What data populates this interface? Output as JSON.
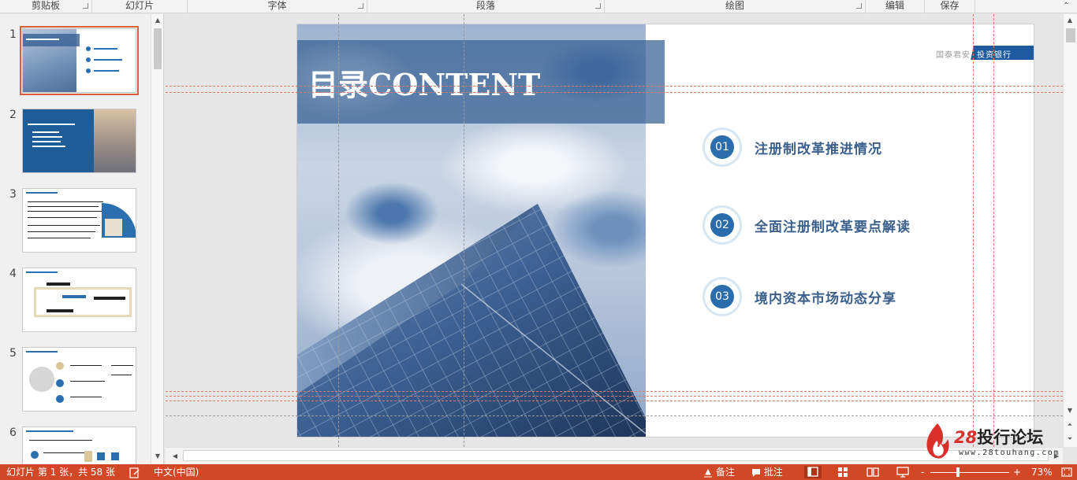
{
  "ribbon": {
    "groups": [
      {
        "label": "剪贴板",
        "launcher": true
      },
      {
        "label": "幻灯片",
        "launcher": false
      },
      {
        "label": "字体",
        "launcher": true
      },
      {
        "label": "段落",
        "launcher": true
      },
      {
        "label": "绘图",
        "launcher": true
      },
      {
        "label": "编辑",
        "launcher": false
      },
      {
        "label": "保存",
        "launcher": false
      }
    ]
  },
  "thumbnails": {
    "items": [
      {
        "num": "1"
      },
      {
        "num": "2"
      },
      {
        "num": "3"
      },
      {
        "num": "4"
      },
      {
        "num": "5"
      },
      {
        "num": "6"
      }
    ],
    "selected": "1"
  },
  "slide": {
    "title": "目录CONTENT",
    "logo_left": "国泰君安",
    "logo_right": "投资银行",
    "toc": [
      {
        "num": "01",
        "label": "注册制改革推进情况"
      },
      {
        "num": "02",
        "label": "全面注册制改革要点解读"
      },
      {
        "num": "03",
        "label": "境内资本市场动态分享"
      }
    ]
  },
  "watermark": {
    "number": "28",
    "name": "投行论坛",
    "url": "www.28touhang.com"
  },
  "status": {
    "slide_info": "幻灯片 第 1 张，共 58 张",
    "language": "中文(中国)",
    "notes": "备注",
    "comments": "批注",
    "zoom_minus": "-",
    "zoom_plus": "+",
    "zoom": "73%",
    "zoom_level_percent": 73
  },
  "colors": {
    "accent": "#d24726",
    "slide_blue": "#2b6cac"
  }
}
